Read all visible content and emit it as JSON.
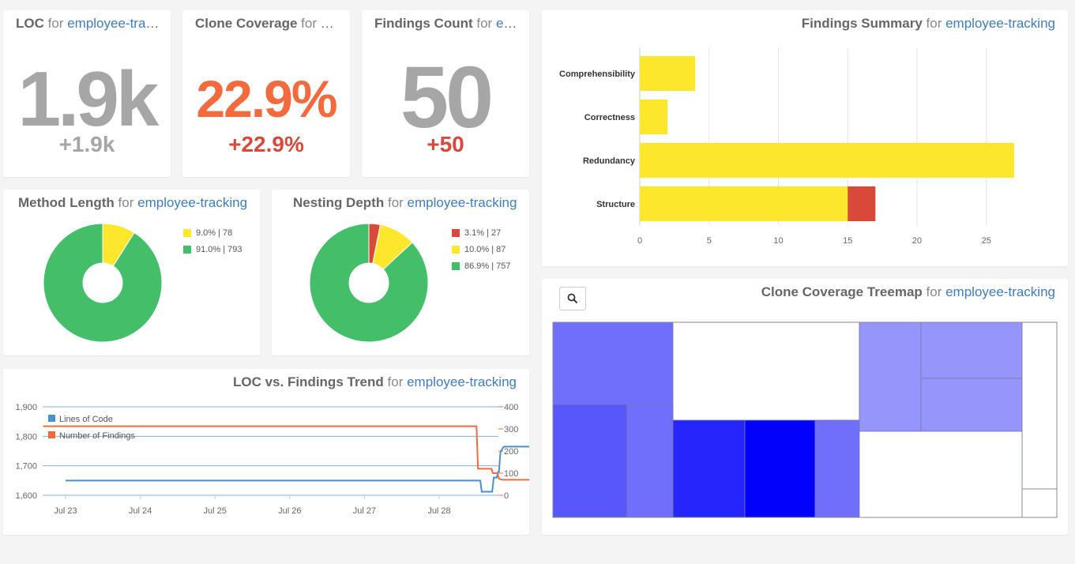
{
  "project": "employee-tracking",
  "for_word": "for",
  "kpis": [
    {
      "title": "LOC",
      "value": "1.9k",
      "delta": "+1.9k",
      "color": "#a6a6a6",
      "delta_color": "#a6a6a6"
    },
    {
      "title": "Clone Coverage",
      "value": "22.9%",
      "delta": "+22.9%",
      "color": "#f26a3d",
      "delta_color": "#d9493a"
    },
    {
      "title": "Findings Count",
      "value": "50",
      "delta": "+50",
      "color": "#a6a6a6",
      "delta_color": "#d9493a"
    }
  ],
  "method_length": {
    "title": "Method Length",
    "legend": [
      {
        "label": "9.0% | 78",
        "color": "#fce72c"
      },
      {
        "label": "91.0% | 793",
        "color": "#45be6a"
      }
    ],
    "slices": [
      {
        "value": 78,
        "color": "#fce72c"
      },
      {
        "value": 793,
        "color": "#45be6a"
      }
    ]
  },
  "nesting_depth": {
    "title": "Nesting Depth",
    "legend": [
      {
        "label": "3.1% | 27",
        "color": "#d9493a"
      },
      {
        "label": "10.0% | 87",
        "color": "#fce72c"
      },
      {
        "label": "86.9% | 757",
        "color": "#45be6a"
      }
    ],
    "slices": [
      {
        "value": 27,
        "color": "#d9493a"
      },
      {
        "value": 87,
        "color": "#fce72c"
      },
      {
        "value": 757,
        "color": "#45be6a"
      }
    ]
  },
  "findings_summary": {
    "title": "Findings Summary"
  },
  "trend": {
    "title": "LOC vs. Findings Trend"
  },
  "treemap": {
    "title": "Clone Coverage Treemap",
    "zoom_icon": "search-icon"
  },
  "chart_data": [
    {
      "type": "bar",
      "orientation": "horizontal",
      "stacked": true,
      "categories": [
        "Comprehensibility",
        "Correctness",
        "Redundancy",
        "Structure"
      ],
      "series": [
        {
          "color": "#fce72c",
          "values": [
            4,
            2,
            27,
            15
          ]
        },
        {
          "color": "#d9493a",
          "values": [
            0,
            0,
            0,
            2
          ]
        }
      ],
      "xlim": [
        0,
        30
      ],
      "xticks": [
        "0",
        "5",
        "10",
        "15",
        "20",
        "25"
      ],
      "grid": true
    },
    {
      "type": "line",
      "x_ticks": [
        "Jul 23",
        "Jul 24",
        "Jul 25",
        "Jul 26",
        "Jul 27",
        "Jul 28"
      ],
      "y_left_ticks": [
        "1,900",
        "1,800",
        "1,700",
        "1,600"
      ],
      "y_right_ticks": [
        "400",
        "300",
        "200",
        "100",
        "0"
      ],
      "y_left_lim": [
        1600,
        1900
      ],
      "y_right_lim": [
        0,
        400
      ],
      "legend": "top-left",
      "series": [
        {
          "name": "Lines of Code",
          "axis": "left",
          "color": "#4a8fcf",
          "points": [
            [
              0,
              1650
            ],
            [
              5.55,
              1650
            ],
            [
              5.57,
              1612
            ],
            [
              5.71,
              1612
            ],
            [
              5.73,
              1660
            ],
            [
              5.77,
              1660
            ],
            [
              5.79,
              1680
            ],
            [
              5.8,
              1680
            ],
            [
              5.82,
              1745
            ],
            [
              5.85,
              1760
            ],
            [
              5.87,
              1765
            ],
            [
              6.7,
              1765
            ],
            [
              6.72,
              1790
            ],
            [
              6.75,
              1870
            ]
          ]
        },
        {
          "name": "Number of Findings",
          "axis": "right",
          "color": "#f26a3d",
          "points": [
            [
              -0.3,
              312
            ],
            [
              5.5,
              312
            ],
            [
              5.52,
              120
            ],
            [
              5.7,
              120
            ],
            [
              5.72,
              100
            ],
            [
              5.78,
              100
            ],
            [
              5.8,
              75
            ],
            [
              5.85,
              70
            ],
            [
              6.7,
              70
            ],
            [
              6.75,
              50
            ]
          ]
        }
      ]
    },
    {
      "type": "treemap",
      "cells": [
        {
          "color": "#6f6ffc"
        },
        {
          "color": "#ffffff"
        },
        {
          "color": "#9595fc"
        },
        {
          "color": "#9595fc"
        },
        {
          "color": "#9595fc"
        },
        {
          "color": "#ffffff"
        },
        {
          "color": "#5757fc"
        },
        {
          "color": "#6f6ffc"
        },
        {
          "color": "#2626fc"
        },
        {
          "color": "#0202fc"
        },
        {
          "color": "#6f6ffc"
        },
        {
          "color": "#ffffff"
        },
        {
          "color": "#ffffff"
        },
        {
          "color": "#ffffff"
        }
      ]
    }
  ]
}
